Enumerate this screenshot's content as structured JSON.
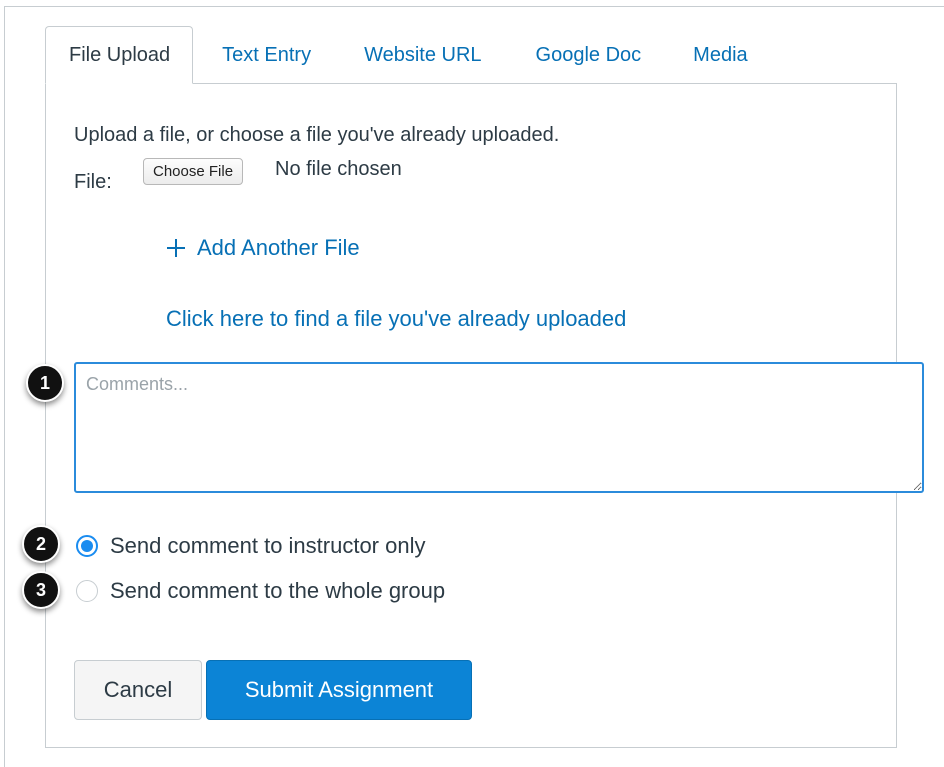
{
  "tabs": [
    {
      "label": "File Upload",
      "active": true
    },
    {
      "label": "Text Entry",
      "active": false
    },
    {
      "label": "Website URL",
      "active": false
    },
    {
      "label": "Google Doc",
      "active": false
    },
    {
      "label": "Media",
      "active": false
    }
  ],
  "upload": {
    "instruction": "Upload a file, or choose a file you've already uploaded.",
    "file_label": "File:",
    "choose_button": "Choose File",
    "no_file_text": "No file chosen",
    "add_another": "Add Another File",
    "find_uploaded": "Click here to find a file you've already uploaded"
  },
  "comments": {
    "placeholder": "Comments...",
    "value": ""
  },
  "callouts": [
    "1",
    "2",
    "3"
  ],
  "radios": [
    {
      "label": "Send comment to instructor only",
      "checked": true
    },
    {
      "label": "Send comment to the whole group",
      "checked": false
    }
  ],
  "buttons": {
    "cancel": "Cancel",
    "submit": "Submit Assignment"
  },
  "colors": {
    "link": "#0770b5",
    "primary": "#0c84d6",
    "focus": "#2b8bdb",
    "text": "#2d3b45",
    "border": "#c7cdd1"
  }
}
